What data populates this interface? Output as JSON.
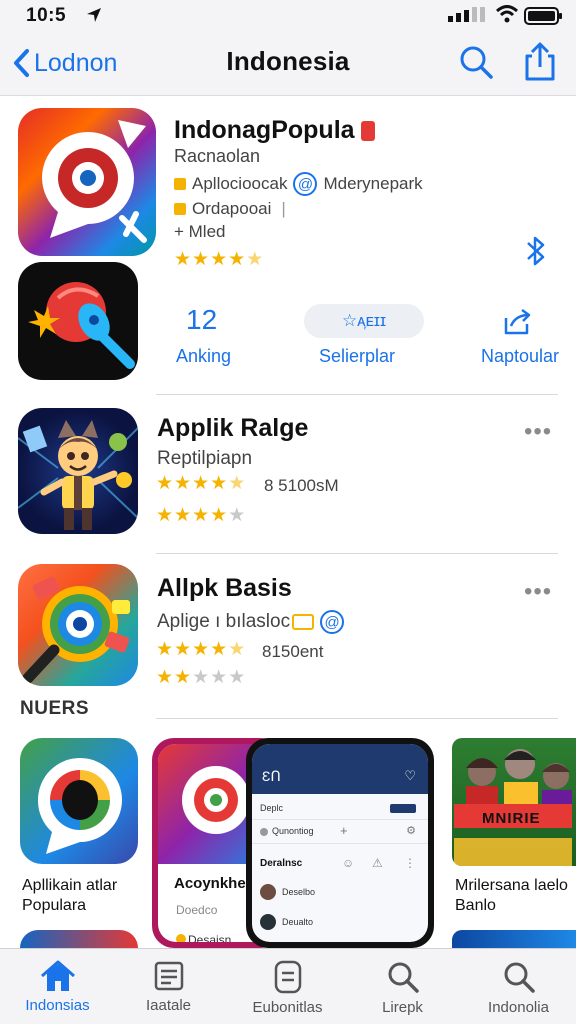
{
  "status": {
    "time": "10:5"
  },
  "nav": {
    "back_label": "Lodnon",
    "title": "Indonesia"
  },
  "featured": {
    "title": "IndonagPopula",
    "subtitle": "Racnaolan",
    "meta1_left": "Apllocioocak",
    "meta1_right": "Mderynepark",
    "meta2": "Ordapooai",
    "meta3": "+ Mled",
    "rating": 4.5
  },
  "stats": [
    {
      "value": "12",
      "label": "Anking"
    },
    {
      "value": "☆ᴀ᷊ᴇɪɪ",
      "label": "Selierplar"
    },
    {
      "value": "",
      "label": "Naptoular"
    }
  ],
  "apps": [
    {
      "title": "Applik Ralge",
      "subtitle": "Reptilpiapn",
      "rating_text": "8 5100sM",
      "rating1": 4.5,
      "rating2": 4
    },
    {
      "title": "Allpk Basis",
      "subtitle": "Aplige ı bılasloc",
      "rating_text": "8150ent",
      "rating1": 4.5,
      "rating2": 2
    }
  ],
  "section_title": "NUERS",
  "cards": [
    {
      "label": "Apllikain atlar Populara"
    },
    {
      "label": "Acoynkhe",
      "sublabel": "Doedco",
      "footer": "Desaisn"
    },
    {
      "phone_header": "ƐՈ",
      "rows": [
        "Deplc",
        "Qunontiog",
        "Deralnsc",
        "Deselbo",
        "Deualto"
      ]
    },
    {
      "label": "Mrilersana laelo Banlo",
      "poster_text": "MNIRIE"
    }
  ],
  "tabs": [
    {
      "label": "Indonsias",
      "icon": "home-icon",
      "active": true
    },
    {
      "label": "Iaatale",
      "icon": "news-icon",
      "active": false
    },
    {
      "label": "Eubonitlas",
      "icon": "document-icon",
      "active": false
    },
    {
      "label": "Lirepk",
      "icon": "search-icon",
      "active": false
    },
    {
      "label": "Indonolia",
      "icon": "search-icon",
      "active": false
    }
  ],
  "colors": {
    "accent": "#1a73e8",
    "star": "#f5b301"
  }
}
